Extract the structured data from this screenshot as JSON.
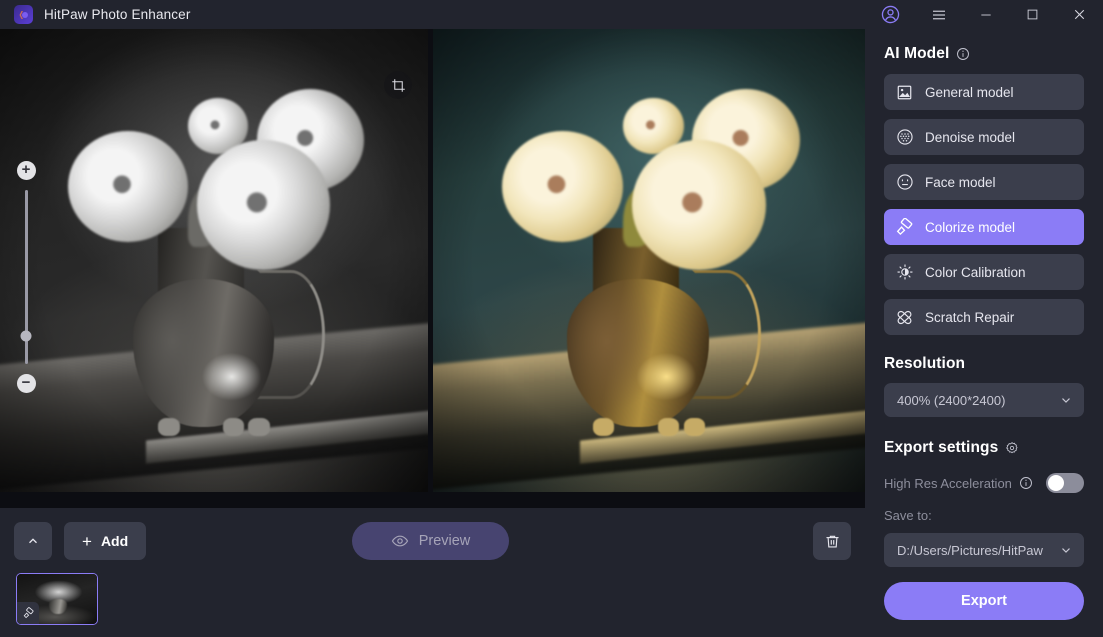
{
  "window": {
    "title": "HitPaw Photo Enhancer",
    "logo_icon": "hitpaw-logo-icon",
    "controls": [
      {
        "name": "account-button",
        "icon": "user-circle-icon"
      },
      {
        "name": "menu-button",
        "icon": "hamburger-menu-icon"
      },
      {
        "name": "minimize-button",
        "icon": "minimize-icon"
      },
      {
        "name": "maximize-button",
        "icon": "maximize-square-icon"
      },
      {
        "name": "close-button",
        "icon": "close-x-icon"
      }
    ]
  },
  "stage": {
    "original_label": "original-photo",
    "enhanced_label": "enhanced-photo",
    "crop_icon": "crop-icon",
    "zoom": {
      "zoom_in": "+",
      "zoom_out": "−",
      "handle_position_percent": 16
    }
  },
  "bottom_bar": {
    "collapse_icon": "chevron-up-icon",
    "add_label": "Add",
    "add_plus": "+",
    "preview_label": "Preview",
    "preview_icon": "eye-icon",
    "delete_icon": "trash-icon",
    "thumbnail": {
      "name": "thumbnail-original",
      "badge_icon": "colorize-roller-icon",
      "selected": true
    }
  },
  "right_panel": {
    "ai_model": {
      "title": "AI Model",
      "info_icon": "info-circle-icon",
      "models": [
        {
          "label": "General model",
          "icon": "picture-icon",
          "active": false
        },
        {
          "label": "Denoise model",
          "icon": "halftone-circle-icon",
          "active": false
        },
        {
          "label": "Face model",
          "icon": "face-icon",
          "active": false
        },
        {
          "label": "Colorize model",
          "icon": "colorize-roller-icon",
          "active": true
        },
        {
          "label": "Color Calibration",
          "icon": "half-sun-icon",
          "active": false
        },
        {
          "label": "Scratch Repair",
          "icon": "bandage-icon",
          "active": false
        }
      ]
    },
    "resolution": {
      "title": "Resolution",
      "selected": "400% (2400*2400)",
      "chevron_icon": "chevron-down-icon"
    },
    "export_settings": {
      "title": "Export settings",
      "gear_icon": "gear-icon",
      "high_res_label": "High Res Acceleration",
      "high_res_info_icon": "info-circle-icon",
      "high_res_enabled": false,
      "save_to_label": "Save to:",
      "save_to_path": "D:/Users/Pictures/HitPaw",
      "save_chevron_icon": "chevron-down-icon",
      "export_label": "Export"
    }
  },
  "colors": {
    "accent": "#8b7cf6",
    "panel": "#22242e",
    "control": "#3b3e4c",
    "canvas": "#0c0d12",
    "preview_disabled": "#474470",
    "muted_text": "#8d8e9c"
  }
}
